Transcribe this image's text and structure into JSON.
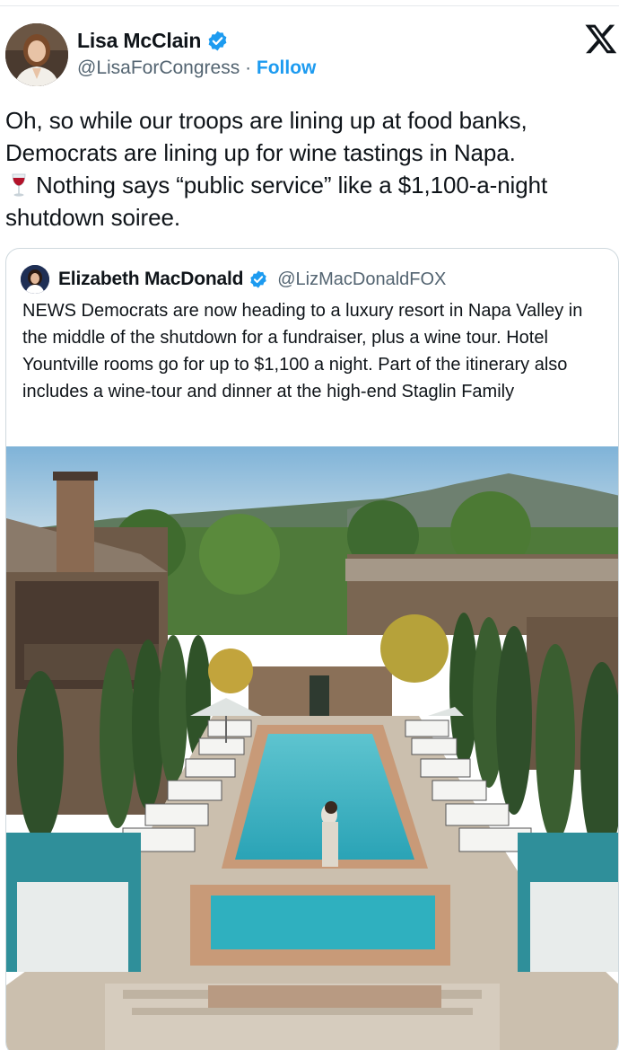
{
  "tweet": {
    "author": {
      "display_name": "Lisa McClain",
      "handle": "@LisaForCongress",
      "separator": "·",
      "follow_label": "Follow",
      "verified": true
    },
    "platform_icon": "x-logo-icon",
    "text_line1": "Oh, so while our troops are lining up at food banks, Democrats are lining up for wine tastings in Napa.",
    "wine_emoji_icon": "wine-glass-icon",
    "text_line2": "Nothing says “public service” like a $1,100-a-night shutdown soiree.",
    "colors": {
      "accent": "#1d9bf0",
      "text": "#0f1419",
      "muted": "#536471",
      "border": "#cfd9de"
    }
  },
  "quoted_tweet": {
    "author": {
      "display_name": "Elizabeth MacDonald",
      "handle": "@LizMacDonaldFOX",
      "verified": true
    },
    "text": "NEWS Democrats are now heading to a luxury resort in Napa Valley in the middle of the shutdown for a fundraiser, plus a wine tour. Hotel Yountville rooms go for up to $1,100 a night. Part of the itinerary also includes a wine-tour and dinner at the high-end Staglin Family",
    "image": "resort-pool-courtyard-photo"
  }
}
